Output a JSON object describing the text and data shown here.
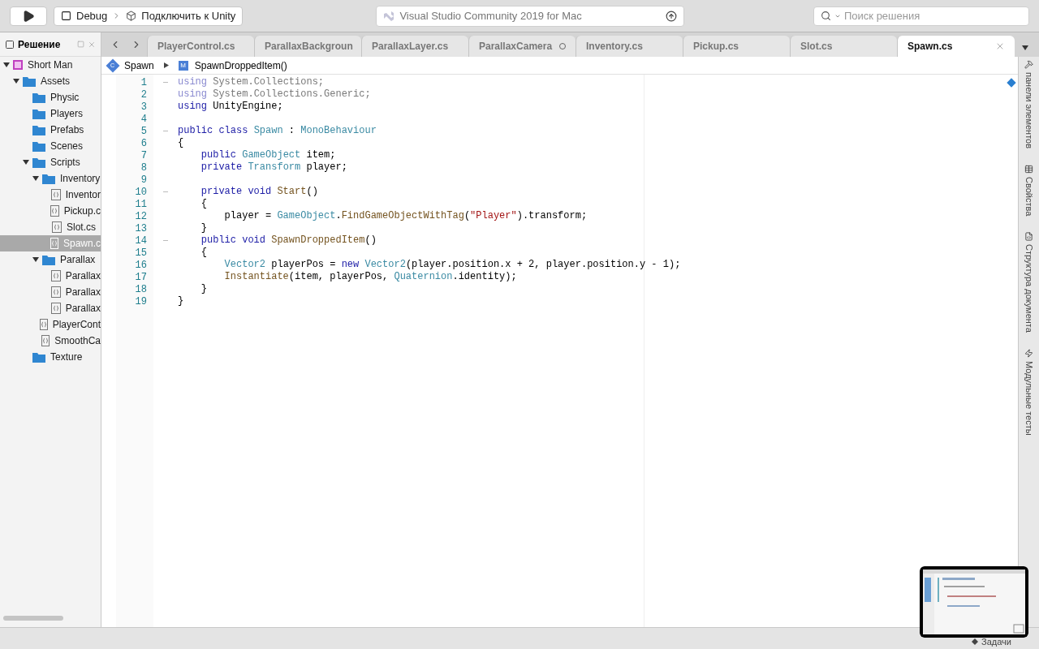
{
  "toolbar": {
    "config": "Debug",
    "target": "Подключить к Unity",
    "title": "Visual Studio Community 2019 for Mac",
    "search": {
      "placeholder": "Поиск решения"
    }
  },
  "solution": {
    "title": "Решение",
    "tree": [
      {
        "label": "Short Man",
        "kind": "project",
        "expanded": true,
        "selected": false,
        "children": [
          {
            "label": "Assets",
            "kind": "folder",
            "expanded": true,
            "selected": false,
            "children": [
              {
                "label": "Physic",
                "kind": "folder",
                "selected": false
              },
              {
                "label": "Players",
                "kind": "folder",
                "selected": false
              },
              {
                "label": "Prefabs",
                "kind": "folder",
                "selected": false
              },
              {
                "label": "Scenes",
                "kind": "folder",
                "selected": false
              },
              {
                "label": "Scripts",
                "kind": "folder",
                "expanded": true,
                "selected": false,
                "children": [
                  {
                    "label": "Inventory",
                    "kind": "folder",
                    "expanded": true,
                    "selected": false,
                    "children": [
                      {
                        "label": "Inventor",
                        "kind": "file",
                        "selected": false
                      },
                      {
                        "label": "Pickup.c",
                        "kind": "file",
                        "selected": false
                      },
                      {
                        "label": "Slot.cs",
                        "kind": "file",
                        "selected": false
                      },
                      {
                        "label": "Spawn.c",
                        "kind": "file",
                        "selected": true
                      }
                    ]
                  },
                  {
                    "label": "Parallax",
                    "kind": "folder",
                    "expanded": true,
                    "selected": false,
                    "children": [
                      {
                        "label": "Parallax",
                        "kind": "file",
                        "selected": false
                      },
                      {
                        "label": "Parallax",
                        "kind": "file",
                        "selected": false
                      },
                      {
                        "label": "Parallax",
                        "kind": "file",
                        "selected": false
                      }
                    ]
                  },
                  {
                    "label": "PlayerCont",
                    "kind": "file",
                    "selected": false
                  },
                  {
                    "label": "SmoothCa",
                    "kind": "file",
                    "selected": false
                  }
                ]
              },
              {
                "label": "Texture",
                "kind": "folder",
                "selected": false
              }
            ]
          }
        ]
      }
    ]
  },
  "tabs": [
    {
      "label": "PlayerControl.cs",
      "selected": false,
      "modified": false
    },
    {
      "label": "ParallaxBackgroun",
      "selected": false,
      "modified": false
    },
    {
      "label": "ParallaxLayer.cs",
      "selected": false,
      "modified": false
    },
    {
      "label": "ParallaxCamera",
      "selected": false,
      "modified": true
    },
    {
      "label": "Inventory.cs",
      "selected": false,
      "modified": false
    },
    {
      "label": "Pickup.cs",
      "selected": false,
      "modified": false
    },
    {
      "label": "Slot.cs",
      "selected": false,
      "modified": false
    },
    {
      "label": "Spawn.cs",
      "selected": true,
      "modified": false
    }
  ],
  "breadcrumb": [
    {
      "kind": "class",
      "badge": "C",
      "label": "Spawn"
    },
    {
      "kind": "method",
      "badge": "M",
      "label": "SpawnDroppedItem()"
    }
  ],
  "code": [
    {
      "n": "1",
      "fold": true,
      "tokens": [
        {
          "text": "using ",
          "kind": "dim"
        },
        {
          "text": "System.Collections;",
          "kind": "grey"
        }
      ]
    },
    {
      "n": "2",
      "fold": false,
      "tokens": [
        {
          "text": "using ",
          "kind": "dim"
        },
        {
          "text": "System.Collections.Generic;",
          "kind": "grey"
        }
      ]
    },
    {
      "n": "3",
      "fold": false,
      "tokens": [
        {
          "text": "using ",
          "kind": "kw"
        },
        {
          "text": "UnityEngine;",
          "kind": "plain"
        }
      ]
    },
    {
      "n": "4",
      "fold": false
    },
    {
      "n": "5",
      "fold": true,
      "tokens": [
        {
          "text": "public class ",
          "kind": "kw"
        },
        {
          "text": "Spawn",
          "kind": "type"
        },
        {
          "text": " : ",
          "kind": "plain"
        },
        {
          "text": "MonoBehaviour",
          "kind": "type"
        }
      ]
    },
    {
      "n": "6",
      "fold": false,
      "tokens": [
        {
          "text": "{",
          "kind": "plain"
        }
      ]
    },
    {
      "n": "7",
      "fold": false,
      "tokens": [
        {
          "text": "    public ",
          "kind": "kw"
        },
        {
          "text": "GameObject",
          "kind": "type"
        },
        {
          "text": " item;",
          "kind": "plain"
        }
      ]
    },
    {
      "n": "8",
      "fold": false,
      "tokens": [
        {
          "text": "    private ",
          "kind": "kw"
        },
        {
          "text": "Transform",
          "kind": "type"
        },
        {
          "text": " player;",
          "kind": "plain"
        }
      ]
    },
    {
      "n": "9",
      "fold": false
    },
    {
      "n": "10",
      "fold": true,
      "tokens": [
        {
          "text": "    private void ",
          "kind": "kw"
        },
        {
          "text": "Start",
          "kind": "method"
        },
        {
          "text": "()",
          "kind": "plain"
        }
      ]
    },
    {
      "n": "11",
      "fold": false,
      "tokens": [
        {
          "text": "    {",
          "kind": "plain"
        }
      ]
    },
    {
      "n": "12",
      "fold": false,
      "tokens": [
        {
          "text": "        player = ",
          "kind": "plain"
        },
        {
          "text": "GameObject",
          "kind": "type"
        },
        {
          "text": ".",
          "kind": "plain"
        },
        {
          "text": "FindGameObjectWithTag",
          "kind": "method"
        },
        {
          "text": "(",
          "kind": "plain"
        },
        {
          "text": "\"Player\"",
          "kind": "string"
        },
        {
          "text": ").transform;",
          "kind": "plain"
        }
      ]
    },
    {
      "n": "13",
      "fold": false,
      "tokens": [
        {
          "text": "    }",
          "kind": "plain"
        }
      ]
    },
    {
      "n": "14",
      "fold": true,
      "tokens": [
        {
          "text": "    public void ",
          "kind": "kw"
        },
        {
          "text": "SpawnDroppedItem",
          "kind": "method"
        },
        {
          "text": "()",
          "kind": "plain"
        }
      ]
    },
    {
      "n": "15",
      "fold": false,
      "tokens": [
        {
          "text": "    {",
          "kind": "plain"
        }
      ]
    },
    {
      "n": "16",
      "fold": false,
      "tokens": [
        {
          "text": "        Vector2",
          "kind": "type"
        },
        {
          "text": " playerPos = ",
          "kind": "plain"
        },
        {
          "text": "new ",
          "kind": "kw"
        },
        {
          "text": "Vector2",
          "kind": "type"
        },
        {
          "text": "(player.position.x + 2, player.position.y - 1);",
          "kind": "plain"
        }
      ]
    },
    {
      "n": "17",
      "fold": false,
      "tokens": [
        {
          "text": "        Instantiate",
          "kind": "method"
        },
        {
          "text": "(item, playerPos, ",
          "kind": "plain"
        },
        {
          "text": "Quaternion",
          "kind": "type"
        },
        {
          "text": ".identity);",
          "kind": "plain"
        }
      ]
    },
    {
      "n": "18",
      "fold": false,
      "tokens": [
        {
          "text": "    }",
          "kind": "plain"
        }
      ]
    },
    {
      "n": "19",
      "fold": false,
      "tokens": [
        {
          "text": "}",
          "kind": "plain"
        }
      ]
    }
  ],
  "right_pads": [
    {
      "kind": "toolbox",
      "label": "панели элементов"
    },
    {
      "kind": "properties",
      "label": "Свойства"
    },
    {
      "kind": "outline",
      "label": "Структура документа"
    },
    {
      "kind": "tests",
      "label": "Модульные тесты"
    }
  ],
  "status_bar": {
    "tasks": "Задачи"
  }
}
